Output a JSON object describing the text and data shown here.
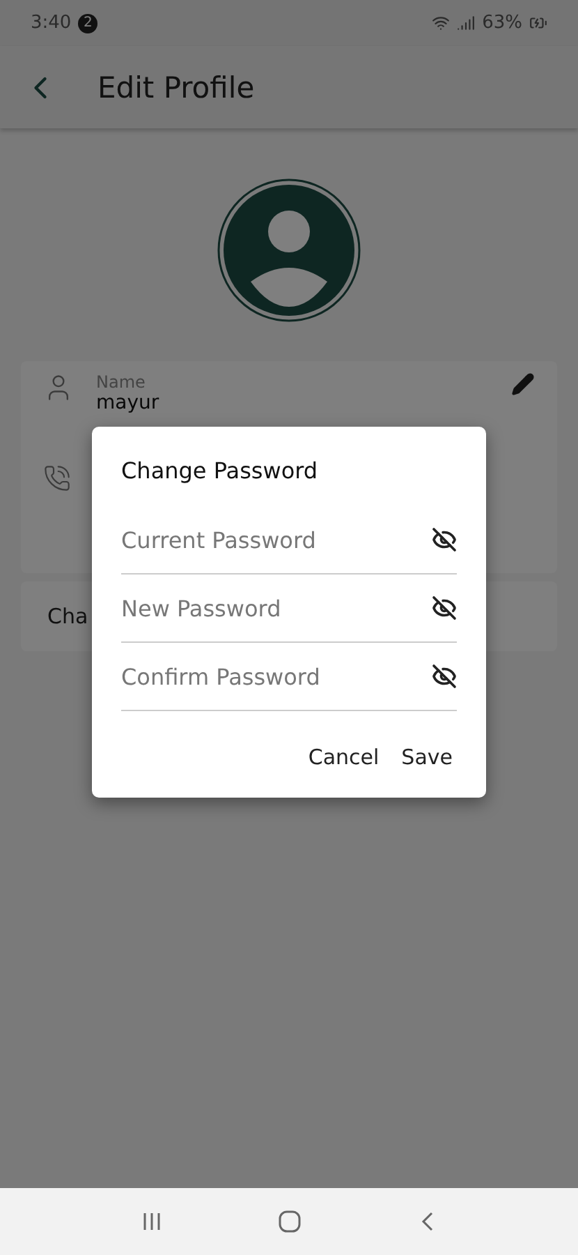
{
  "status_bar": {
    "time": "3:40",
    "notification_count": "2",
    "battery": "63%"
  },
  "app_bar": {
    "title": "Edit Profile"
  },
  "profile": {
    "name_label": "Name",
    "name_value": "mayur",
    "change_row": "Cha"
  },
  "dialog": {
    "title": "Change Password",
    "fields": [
      {
        "placeholder": "Current Password"
      },
      {
        "placeholder": "New Password"
      },
      {
        "placeholder": "Confirm Password"
      }
    ],
    "buttons": [
      "Cancel",
      "Save"
    ]
  }
}
